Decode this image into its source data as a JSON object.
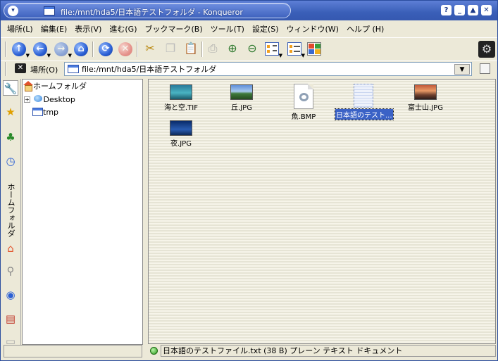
{
  "window": {
    "title": "file:/mnt/hda5/日本語テストフォルダ - Konqueror",
    "buttons": [
      "?",
      "_",
      "▲",
      "✕"
    ]
  },
  "menu": [
    "場所(L)",
    "編集(E)",
    "表示(V)",
    "進む(G)",
    "ブックマーク(B)",
    "ツール(T)",
    "設定(S)",
    "ウィンドウ(W)",
    "ヘルプ (H)"
  ],
  "toolbar": {
    "icons": [
      "up-icon",
      "back-icon",
      "forward-icon",
      "home-icon",
      "reload-icon",
      "stop-icon",
      "cut-icon",
      "copy-icon",
      "paste-icon",
      "print-icon",
      "zoom-in-icon",
      "zoom-out-icon",
      "icon-view-icon",
      "detail-view-icon",
      "tile-view-icon",
      "gear-icon"
    ]
  },
  "location": {
    "label": "場所(O)",
    "value": "file:/mnt/hda5/日本語テストフォルダ"
  },
  "sidebar": {
    "vertical_label": "ホームフォルダ",
    "tree": {
      "root": "ホームフォルダ",
      "children": [
        "Desktop",
        "tmp"
      ]
    }
  },
  "files": [
    {
      "name": "海と空.TIF",
      "type": "image"
    },
    {
      "name": "丘.JPG",
      "type": "image"
    },
    {
      "name": "魚.BMP",
      "type": "bmp"
    },
    {
      "name": "日本語のテスト...",
      "type": "text",
      "selected": true
    },
    {
      "name": "富士山.JPG",
      "type": "image"
    },
    {
      "name": "夜.JPG",
      "type": "image"
    }
  ],
  "status": {
    "text": "日本語のテストファイル.txt (38 B)  プレーン テキスト ドキュメント"
  }
}
